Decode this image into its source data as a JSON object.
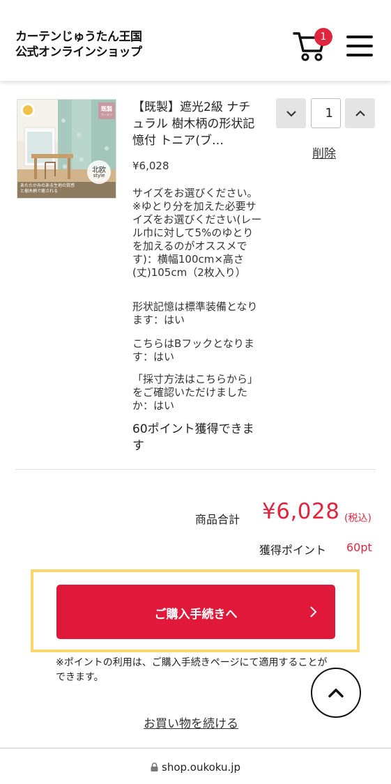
{
  "header": {
    "logo_line1": "カーテンじゅうたん王国",
    "logo_line2": "公式オンラインショップ",
    "cart_count": "1"
  },
  "product": {
    "title": "【既製】遮光2級 ナチュラル 樹木柄の形状記憶付 トニア(ブ…",
    "price": "¥6,028",
    "options": [
      "サイズをお選びください。※ゆとり分を加えた必要サイズをお選びください(レール巾に対して5%のゆとりを加えるのがオススメです)：横幅100cm×高さ(丈)105cm（2枚入り）",
      "形状記憶は標準装備となります：はい",
      "こちらはBフックとなります：はい",
      "「採寸方法はこちらから」をご確認いただけましたか：はい"
    ],
    "points_text": "60ポイント獲得できます",
    "quantity": "1",
    "delete_label": "削除",
    "thumb_tag": "既製",
    "thumb_tag_sub": "カーテン",
    "thumb_badge": "北欧",
    "thumb_badge_sub": "style",
    "thumb_caption": "あたたかみのある生地の質感と樹木柄で癒される"
  },
  "summary": {
    "total_label": "商品合計",
    "total_value": "¥6,028",
    "tax_label": "(税込)",
    "points_label": "獲得ポイント",
    "points_value": "60pt"
  },
  "checkout": {
    "button_label": "ご購入手続きへ",
    "note": "※ポイントの利用は、ご購入手続きページにて適用することができます。",
    "continue_label": "お買い物を続ける"
  },
  "browser": {
    "url": "shop.oukoku.jp"
  },
  "colors": {
    "accent": "#e0263f",
    "highlight": "#f8d66a"
  }
}
